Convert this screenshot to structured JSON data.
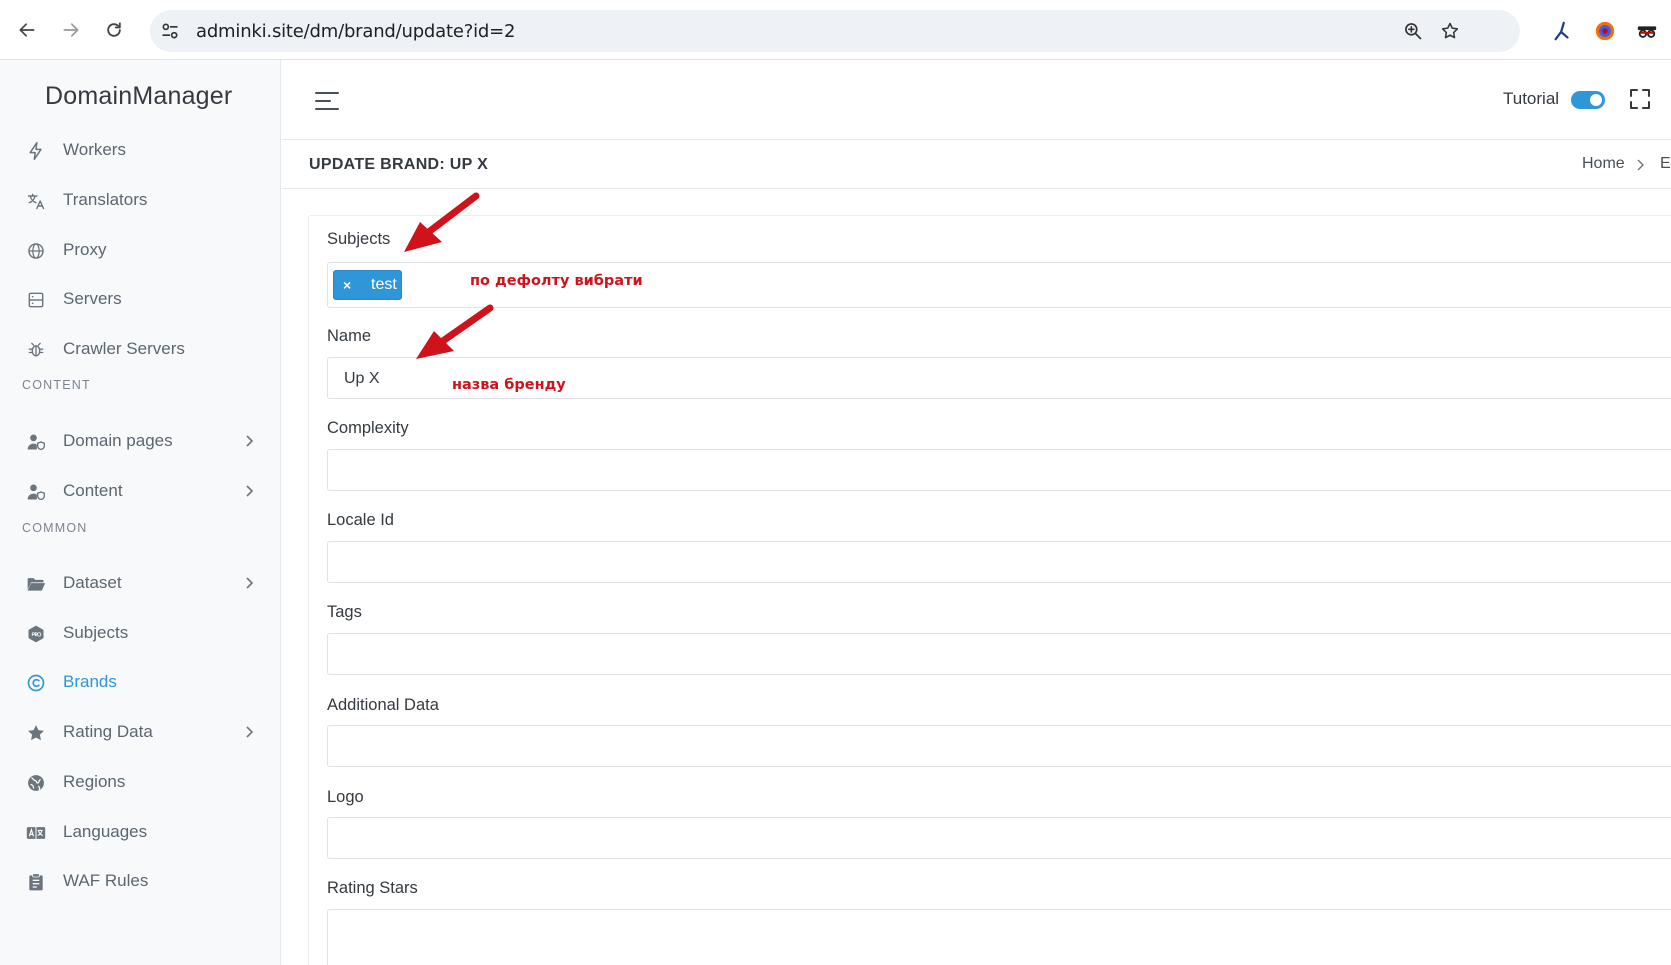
{
  "browser": {
    "url": "adminki.site/dm/brand/update?id=2",
    "icons": [
      "back-icon",
      "forward-icon",
      "reload-icon",
      "tune-icon",
      "zoom-icon",
      "star-icon",
      "extension-icons"
    ]
  },
  "sidebar": {
    "brand": "DomainManager",
    "items": [
      {
        "label": "Workers",
        "icon": "bolt-icon"
      },
      {
        "label": "Translators",
        "icon": "translate-icon"
      },
      {
        "label": "Proxy",
        "icon": "globe-icon"
      },
      {
        "label": "Servers",
        "icon": "server-icon"
      },
      {
        "label": "Crawler Servers",
        "icon": "bug-icon"
      }
    ],
    "section_content": "CONTENT",
    "content_items": [
      {
        "label": "Domain pages",
        "icon": "user-shield-icon"
      },
      {
        "label": "Content",
        "icon": "user-shield-icon"
      }
    ],
    "section_common": "COMMON",
    "common_items": [
      {
        "label": "Dataset",
        "icon": "folder-icon"
      },
      {
        "label": "Subjects",
        "icon": "pro-badge-icon"
      },
      {
        "label": "Brands",
        "icon": "copyright-icon",
        "active": true
      },
      {
        "label": "Rating Data",
        "icon": "star-icon"
      },
      {
        "label": "Regions",
        "icon": "earth-icon"
      },
      {
        "label": "Languages",
        "icon": "language-icon"
      },
      {
        "label": "WAF Rules",
        "icon": "clipboard-icon"
      }
    ],
    "active_color": "#2f96d8"
  },
  "topbar": {
    "tutorial_label": "Tutorial",
    "tutorial_on": true
  },
  "page": {
    "title": "UPDATE BRAND: UP X",
    "breadcrumb": [
      "Home",
      "E"
    ]
  },
  "form": {
    "subjects_label": "Subjects",
    "subjects_tag": "test",
    "subjects_tag_remove": "×",
    "name_label": "Name",
    "name_value": "Up X",
    "complexity_label": "Complexity",
    "locale_label": "Locale Id",
    "tags_label": "Tags",
    "additional_label": "Additional Data",
    "logo_label": "Logo",
    "rating_label": "Rating Stars"
  },
  "annotations": {
    "subjects_note": "по дефолту вибрати",
    "name_note": "назва бренду",
    "color": "#d0121b"
  }
}
